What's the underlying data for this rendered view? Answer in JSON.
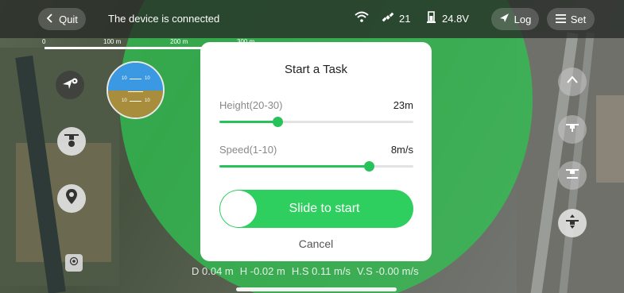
{
  "topbar": {
    "quit_label": "Quit",
    "status_text": "The device is connected",
    "satellites": "21",
    "voltage": "24.8V",
    "log_label": "Log",
    "set_label": "Set"
  },
  "scale": {
    "tick0": "0",
    "tick1": "100 m",
    "tick2": "200 m",
    "tick3": "300 m"
  },
  "attitude": {
    "upper_left": "10",
    "upper_right": "10",
    "lower_left": "10",
    "lower_right": "10"
  },
  "modal": {
    "title": "Start a Task",
    "height_label": "Height(20-30)",
    "height_value": "23m",
    "height_fraction": 0.3,
    "speed_label": "Speed(1-10)",
    "speed_value": "8m/s",
    "speed_fraction": 0.77,
    "slide_label": "Slide to start",
    "cancel_label": "Cancel"
  },
  "telemetry": {
    "d": "D 0.04 m",
    "h": "H -0.02 m",
    "hs": "H.S 0.11 m/s",
    "vs": "V.S -0.00 m/s"
  },
  "icons": {
    "back": "chevron-left-icon",
    "wifi": "wifi-icon",
    "satellite": "satellite-icon",
    "battery": "battery-icon",
    "log": "paper-plane-icon",
    "set": "menu-icon",
    "nav": "location-arrow-icon",
    "drone": "drone-icon",
    "pin": "map-pin-icon",
    "target": "target-icon"
  },
  "colors": {
    "accent": "#2fcf5f",
    "zone": "#2ec850",
    "sky": "#3b98e3",
    "ground": "#a88d3c"
  }
}
